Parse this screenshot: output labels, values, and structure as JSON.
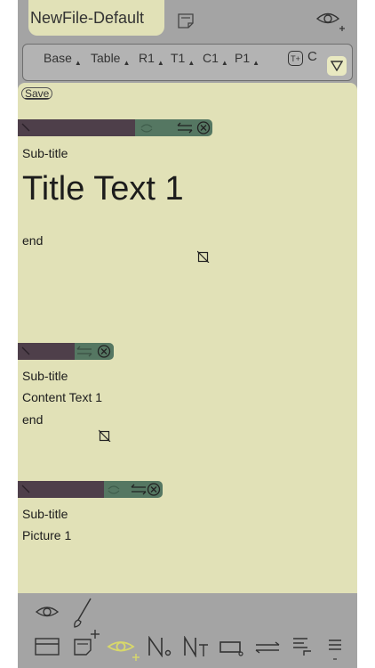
{
  "header": {
    "filename": "NewFile-Default"
  },
  "tabs": [
    {
      "label": "Base"
    },
    {
      "label": "Table"
    },
    {
      "label": "R1"
    },
    {
      "label": "T1"
    },
    {
      "label": "C1"
    },
    {
      "label": "P1"
    }
  ],
  "tab_extra": {
    "t_plus": "T+",
    "c_short": "C"
  },
  "save_label": "Save",
  "blocks": [
    {
      "subtitle": "Sub-title",
      "title": "Title Text 1",
      "end": "end"
    },
    {
      "subtitle": "Sub-title",
      "content": "Content Text 1",
      "end": "end"
    },
    {
      "subtitle": "Sub-title",
      "content": "Picture 1"
    }
  ],
  "colors": {
    "panel": "#e1e1b7",
    "chrome": "#a4a4a4",
    "bar_dark": "#4e3f4a",
    "bar_green": "#557762",
    "accent_eye": "#d8d86a"
  },
  "icons": [
    "note-icon",
    "eye-plus-icon",
    "triangle-down-icon",
    "close-circle-icon",
    "swap-arrows-icon",
    "resize-icon",
    "eye-icon",
    "brush-icon",
    "card-icon",
    "note-add-icon",
    "number-icon",
    "number-t-icon",
    "rect-icon",
    "arrows-icon",
    "align-icon",
    "menu-icon"
  ]
}
